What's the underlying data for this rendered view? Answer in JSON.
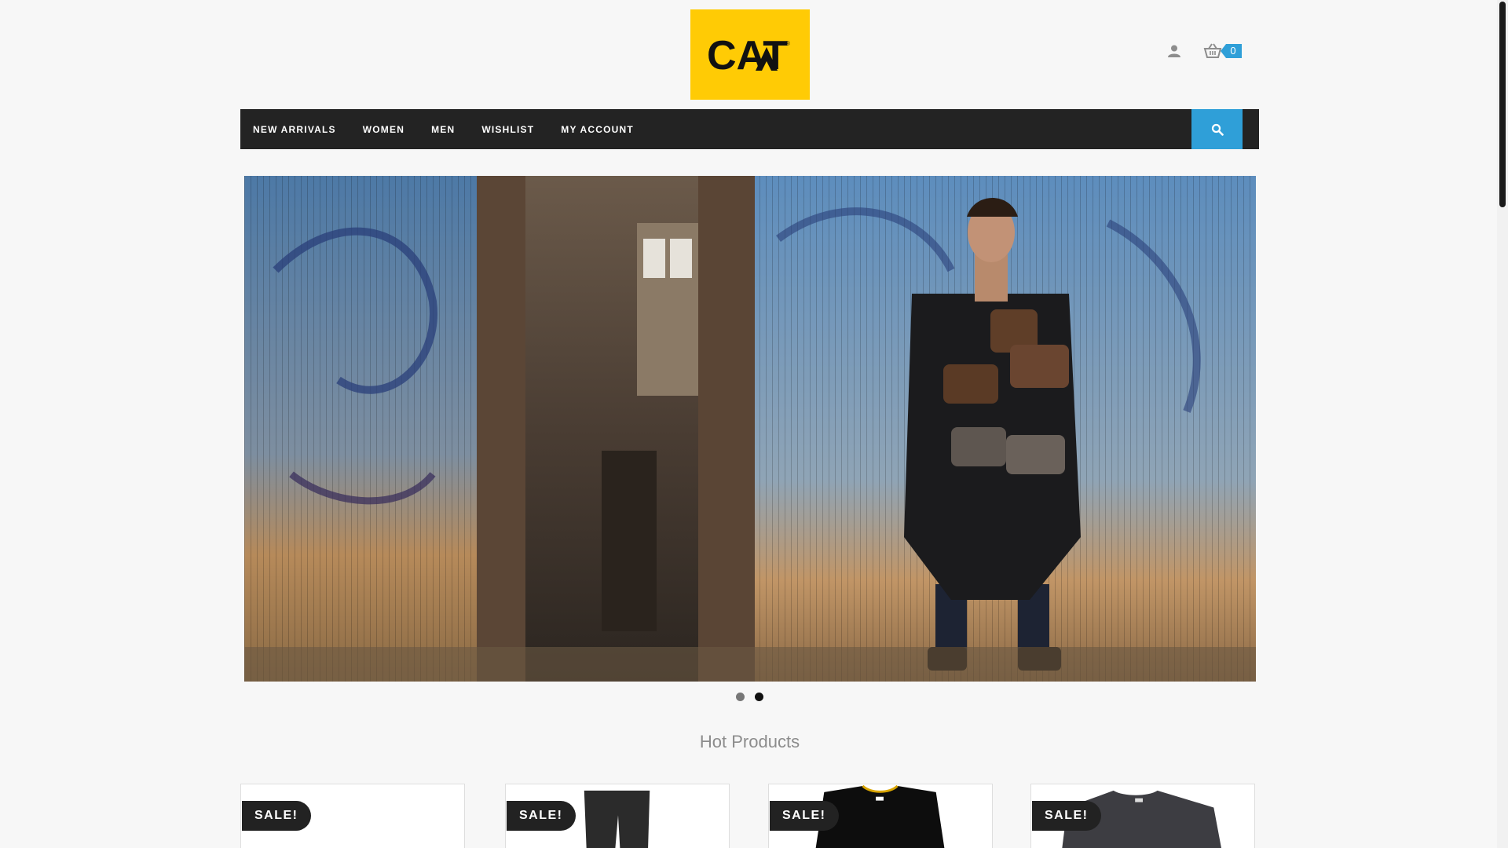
{
  "brand": {
    "logo_text": "CAT",
    "logo_bg": "#ffcb05"
  },
  "header": {
    "cart_count": "0",
    "user_icon": "user-icon",
    "cart_icon": "basket-icon"
  },
  "nav": {
    "items": [
      "NEW ARRIVALS",
      "WOMEN",
      "MEN",
      "WISHLIST",
      "MY ACCOUNT"
    ],
    "search_icon": "search-icon",
    "accent": "#2f9fd8"
  },
  "slider": {
    "slide_count": 2,
    "active_index": 1
  },
  "hot_products": {
    "title": "Hot Products",
    "items": [
      {
        "badge": "SALE!"
      },
      {
        "badge": "SALE!"
      },
      {
        "badge": "SALE!"
      },
      {
        "badge": "SALE!"
      }
    ]
  }
}
